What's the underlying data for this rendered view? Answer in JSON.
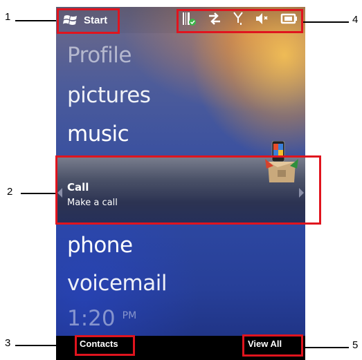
{
  "start": {
    "label": "Start",
    "icon": "windows-flag-icon"
  },
  "status_icons": [
    "barcode-scanner-icon",
    "data-connection-icon",
    "signal-antenna-icon",
    "speaker-muted-icon",
    "battery-icon"
  ],
  "menu": {
    "profile": "Profile",
    "pictures": "pictures",
    "music": "music",
    "phone": "phone",
    "voicemail": "voicemail"
  },
  "call_panel": {
    "title": "Call",
    "subtitle": "Make a call"
  },
  "clock": {
    "time": "1:20",
    "ampm": "PM"
  },
  "softkeys": {
    "left": "Contacts",
    "right": "View All"
  },
  "callouts": [
    "1",
    "2",
    "3",
    "4",
    "5"
  ],
  "colors": {
    "callout_red": "#e0141e",
    "softbar": "#000000"
  }
}
